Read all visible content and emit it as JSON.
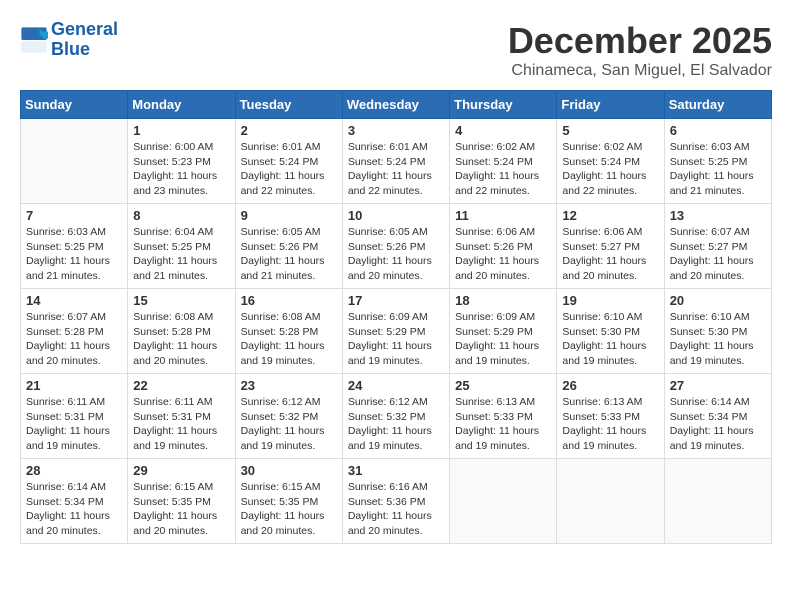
{
  "logo": {
    "line1": "General",
    "line2": "Blue"
  },
  "title": "December 2025",
  "location": "Chinameca, San Miguel, El Salvador",
  "days_of_week": [
    "Sunday",
    "Monday",
    "Tuesday",
    "Wednesday",
    "Thursday",
    "Friday",
    "Saturday"
  ],
  "weeks": [
    [
      {
        "day": "",
        "info": ""
      },
      {
        "day": "1",
        "info": "Sunrise: 6:00 AM\nSunset: 5:23 PM\nDaylight: 11 hours\nand 23 minutes."
      },
      {
        "day": "2",
        "info": "Sunrise: 6:01 AM\nSunset: 5:24 PM\nDaylight: 11 hours\nand 22 minutes."
      },
      {
        "day": "3",
        "info": "Sunrise: 6:01 AM\nSunset: 5:24 PM\nDaylight: 11 hours\nand 22 minutes."
      },
      {
        "day": "4",
        "info": "Sunrise: 6:02 AM\nSunset: 5:24 PM\nDaylight: 11 hours\nand 22 minutes."
      },
      {
        "day": "5",
        "info": "Sunrise: 6:02 AM\nSunset: 5:24 PM\nDaylight: 11 hours\nand 22 minutes."
      },
      {
        "day": "6",
        "info": "Sunrise: 6:03 AM\nSunset: 5:25 PM\nDaylight: 11 hours\nand 21 minutes."
      }
    ],
    [
      {
        "day": "7",
        "info": "Sunrise: 6:03 AM\nSunset: 5:25 PM\nDaylight: 11 hours\nand 21 minutes."
      },
      {
        "day": "8",
        "info": "Sunrise: 6:04 AM\nSunset: 5:25 PM\nDaylight: 11 hours\nand 21 minutes."
      },
      {
        "day": "9",
        "info": "Sunrise: 6:05 AM\nSunset: 5:26 PM\nDaylight: 11 hours\nand 21 minutes."
      },
      {
        "day": "10",
        "info": "Sunrise: 6:05 AM\nSunset: 5:26 PM\nDaylight: 11 hours\nand 20 minutes."
      },
      {
        "day": "11",
        "info": "Sunrise: 6:06 AM\nSunset: 5:26 PM\nDaylight: 11 hours\nand 20 minutes."
      },
      {
        "day": "12",
        "info": "Sunrise: 6:06 AM\nSunset: 5:27 PM\nDaylight: 11 hours\nand 20 minutes."
      },
      {
        "day": "13",
        "info": "Sunrise: 6:07 AM\nSunset: 5:27 PM\nDaylight: 11 hours\nand 20 minutes."
      }
    ],
    [
      {
        "day": "14",
        "info": "Sunrise: 6:07 AM\nSunset: 5:28 PM\nDaylight: 11 hours\nand 20 minutes."
      },
      {
        "day": "15",
        "info": "Sunrise: 6:08 AM\nSunset: 5:28 PM\nDaylight: 11 hours\nand 20 minutes."
      },
      {
        "day": "16",
        "info": "Sunrise: 6:08 AM\nSunset: 5:28 PM\nDaylight: 11 hours\nand 19 minutes."
      },
      {
        "day": "17",
        "info": "Sunrise: 6:09 AM\nSunset: 5:29 PM\nDaylight: 11 hours\nand 19 minutes."
      },
      {
        "day": "18",
        "info": "Sunrise: 6:09 AM\nSunset: 5:29 PM\nDaylight: 11 hours\nand 19 minutes."
      },
      {
        "day": "19",
        "info": "Sunrise: 6:10 AM\nSunset: 5:30 PM\nDaylight: 11 hours\nand 19 minutes."
      },
      {
        "day": "20",
        "info": "Sunrise: 6:10 AM\nSunset: 5:30 PM\nDaylight: 11 hours\nand 19 minutes."
      }
    ],
    [
      {
        "day": "21",
        "info": "Sunrise: 6:11 AM\nSunset: 5:31 PM\nDaylight: 11 hours\nand 19 minutes."
      },
      {
        "day": "22",
        "info": "Sunrise: 6:11 AM\nSunset: 5:31 PM\nDaylight: 11 hours\nand 19 minutes."
      },
      {
        "day": "23",
        "info": "Sunrise: 6:12 AM\nSunset: 5:32 PM\nDaylight: 11 hours\nand 19 minutes."
      },
      {
        "day": "24",
        "info": "Sunrise: 6:12 AM\nSunset: 5:32 PM\nDaylight: 11 hours\nand 19 minutes."
      },
      {
        "day": "25",
        "info": "Sunrise: 6:13 AM\nSunset: 5:33 PM\nDaylight: 11 hours\nand 19 minutes."
      },
      {
        "day": "26",
        "info": "Sunrise: 6:13 AM\nSunset: 5:33 PM\nDaylight: 11 hours\nand 19 minutes."
      },
      {
        "day": "27",
        "info": "Sunrise: 6:14 AM\nSunset: 5:34 PM\nDaylight: 11 hours\nand 19 minutes."
      }
    ],
    [
      {
        "day": "28",
        "info": "Sunrise: 6:14 AM\nSunset: 5:34 PM\nDaylight: 11 hours\nand 20 minutes."
      },
      {
        "day": "29",
        "info": "Sunrise: 6:15 AM\nSunset: 5:35 PM\nDaylight: 11 hours\nand 20 minutes."
      },
      {
        "day": "30",
        "info": "Sunrise: 6:15 AM\nSunset: 5:35 PM\nDaylight: 11 hours\nand 20 minutes."
      },
      {
        "day": "31",
        "info": "Sunrise: 6:16 AM\nSunset: 5:36 PM\nDaylight: 11 hours\nand 20 minutes."
      },
      {
        "day": "",
        "info": ""
      },
      {
        "day": "",
        "info": ""
      },
      {
        "day": "",
        "info": ""
      }
    ]
  ]
}
